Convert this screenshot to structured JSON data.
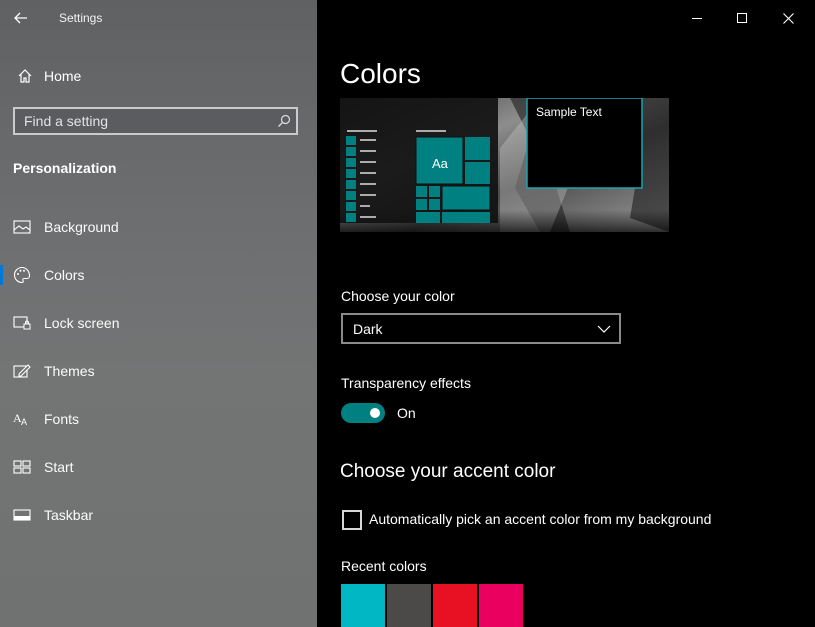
{
  "app": {
    "title": "Settings"
  },
  "sidebar": {
    "home_label": "Home",
    "search_placeholder": "Find a setting",
    "section_title": "Personalization",
    "items": [
      {
        "label": "Background",
        "icon": "picture-icon"
      },
      {
        "label": "Colors",
        "icon": "palette-icon",
        "selected": true
      },
      {
        "label": "Lock screen",
        "icon": "lock-screen-icon"
      },
      {
        "label": "Themes",
        "icon": "themes-icon"
      },
      {
        "label": "Fonts",
        "icon": "fonts-icon"
      },
      {
        "label": "Start",
        "icon": "start-icon"
      },
      {
        "label": "Taskbar",
        "icon": "taskbar-icon"
      }
    ]
  },
  "main": {
    "title": "Colors",
    "preview": {
      "sample_text": "Sample Text",
      "tile_text": "Aa"
    },
    "choose_color": {
      "label": "Choose your color",
      "value": "Dark"
    },
    "transparency": {
      "label": "Transparency effects",
      "state": "On",
      "enabled": true
    },
    "accent": {
      "heading": "Choose your accent color",
      "auto_label": "Automatically pick an accent color from my background",
      "auto_checked": false,
      "recent_label": "Recent colors",
      "recent_colors": [
        "#00b7c3",
        "#4c4a48",
        "#e81123",
        "#ea005e"
      ]
    }
  },
  "colors": {
    "accent": "#008080",
    "selection_indicator": "#0078d7"
  }
}
